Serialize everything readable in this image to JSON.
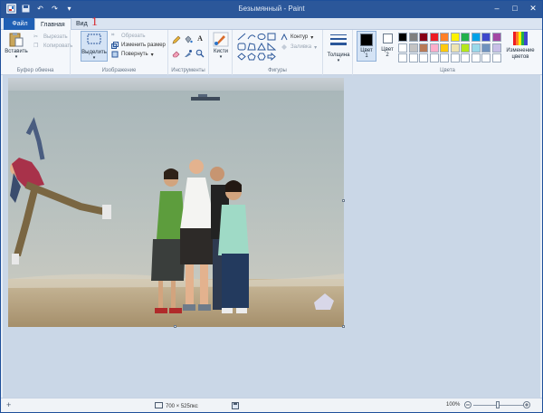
{
  "title": "Безымянный - Paint",
  "tabs": {
    "file": "Файл",
    "home": "Главная",
    "view": "Вид"
  },
  "step_marker": "1",
  "clipboard": {
    "paste_label": "Вставить",
    "cut_label": "Вырезать",
    "copy_label": "Копировать",
    "group_label": "Буфер обмена"
  },
  "image": {
    "select_label": "Выделить",
    "crop_label": "Обрезать",
    "resize_label": "Изменить размер",
    "rotate_label": "Повернуть",
    "group_label": "Изображение"
  },
  "tools": {
    "group_label": "Инструменты",
    "text_tool": "A"
  },
  "brushes": {
    "label": "Кисти"
  },
  "shapes": {
    "outline_label": "Контур",
    "fill_label": "Заливка",
    "group_label": "Фигуры"
  },
  "size": {
    "label": "Толщина"
  },
  "colors": {
    "color1_label": "Цвет",
    "color1_num": "1",
    "color2_label": "Цвет",
    "color2_num": "2",
    "edit_colors_label": "Изменение цветов",
    "group_label": "Цвета",
    "color1_value": "#000000",
    "color2_value": "#ffffff",
    "palette_row1": [
      "#000000",
      "#7f7f7f",
      "#880015",
      "#ed1c24",
      "#ff7f27",
      "#fff200",
      "#22b14c",
      "#00a2e8",
      "#3f48cc",
      "#a349a4"
    ],
    "palette_row2": [
      "#ffffff",
      "#c3c3c3",
      "#b97a57",
      "#ffaec9",
      "#ffc90e",
      "#efe4b0",
      "#b5e61d",
      "#99d9ea",
      "#7092be",
      "#c8bfe7"
    ],
    "palette_row3": [
      "#ffffff",
      "#ffffff",
      "#ffffff",
      "#ffffff",
      "#ffffff",
      "#ffffff",
      "#ffffff",
      "#ffffff",
      "#ffffff",
      "#ffffff"
    ]
  },
  "status": {
    "dimensions": "700 × 525пкс",
    "zoom": "100%",
    "zoom_fraction": 0.5
  }
}
